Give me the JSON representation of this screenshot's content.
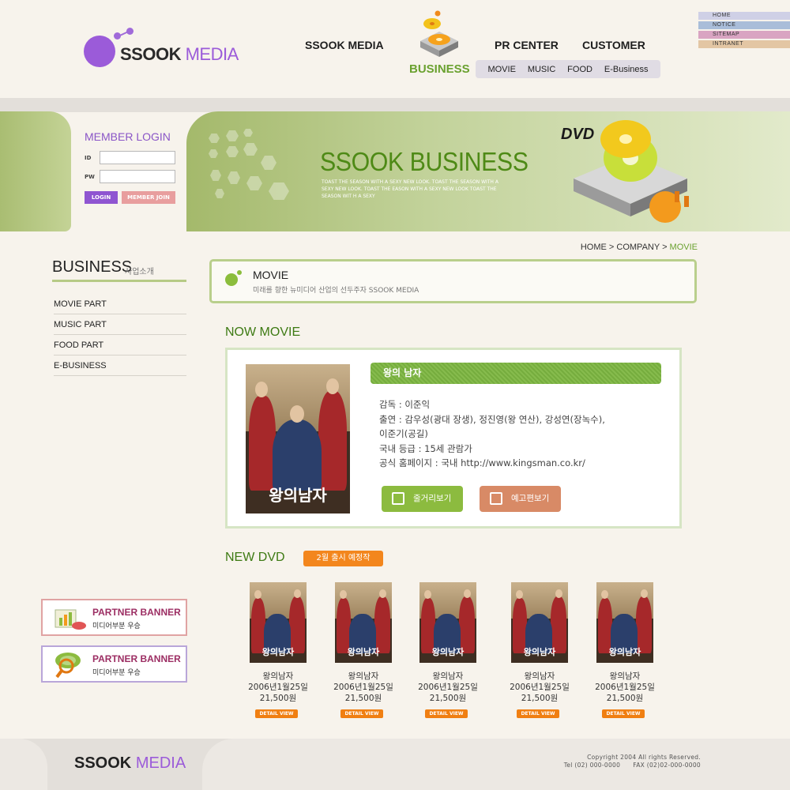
{
  "header": {
    "logo_bold": "SSOOK",
    "logo_light": "MEDIA",
    "gnb": [
      "SSOOK MEDIA",
      "BUSINESS",
      "PR CENTER",
      "CUSTOMER"
    ],
    "sub_menu": [
      "MOVIE",
      "MUSIC",
      "FOOD",
      "E-Business"
    ],
    "utility": [
      "HOME",
      "NOTICE",
      "SITEMAP",
      "INTRANET"
    ],
    "utility_colors": [
      "#cfd0e6",
      "#a9bdd9",
      "#d9a4c2",
      "#e3c6a4"
    ]
  },
  "login": {
    "title": "MEMBER LOGIN",
    "id_label": "ID",
    "pw_label": "PW",
    "login_button": "LOGIN",
    "join_button": "MEMBER JOIN"
  },
  "visual": {
    "title": "SSOOK BUSINESS",
    "desc": "TOAST THE SEASON WITH A SEXY NEW LOOK. TOAST THE SEASON WITH A SEXY NEW LOOK. TOAST THE EASON WITH A SEXY NEW LOOK TOAST THE SEASON WIT H A SEXY",
    "dvd_label": "DVD"
  },
  "sidebar": {
    "title": "BUSINESS",
    "subtitle": "사업소개",
    "items": [
      "MOVIE PART",
      "MUSIC PART",
      "FOOD PART",
      "E-BUSINESS"
    ],
    "banners": [
      {
        "title": "PARTNER BANNER",
        "sub": "미디어부분 우승"
      },
      {
        "title": "PARTNER BANNER",
        "sub": "미디어부분 우승"
      }
    ]
  },
  "breadcrumb": [
    "HOME",
    "COMPANY",
    "MOVIE"
  ],
  "page_head": {
    "title": "MOVIE",
    "desc": "미래를 향한 뉴미디어 산업의 선두주자 SSOOK MEDIA"
  },
  "now_movie": {
    "section_title": "NOW MOVIE",
    "poster_title": "왕의남자",
    "movie_title": "왕의 남자",
    "director": "감독 :  이준익",
    "cast_1": "출연 :  감우성(광대 장생), 정진영(왕 연산), 강성연(장녹수),",
    "cast_2": "이준기(공길)",
    "rating": "국내 등급 :  15세 관람가",
    "site": "공식 홈페이지 :  국내 http://www.kingsman.co.kr/",
    "btn_story": "줄거리보기",
    "btn_trailer": "예고편보기"
  },
  "new_dvd": {
    "section_title": "NEW DVD",
    "badge": "2월 출시 예정작",
    "items": [
      {
        "title": "왕의남자",
        "date": "2006년1월25일",
        "price": "21,500원",
        "button": "DETAIL VIEW"
      },
      {
        "title": "왕의남자",
        "date": "2006년1월25일",
        "price": "21,500원",
        "button": "DETAIL VIEW"
      },
      {
        "title": "왕의남자",
        "date": "2006년1월25일",
        "price": "21,500원",
        "button": "DETAIL VIEW"
      },
      {
        "title": "왕의남자",
        "date": "2006년1월25일",
        "price": "21,500원",
        "button": "DETAIL VIEW"
      },
      {
        "title": "왕의남자",
        "date": "2006년1월25일",
        "price": "21,500원",
        "button": "DETAIL VIEW"
      }
    ]
  },
  "footer": {
    "logo_bold": "SSOOK",
    "logo_light": "MEDIA",
    "copyright": "Copyright 2004 All rights Reserved.",
    "contact": "Tel (02) 000-0000      FAX (02)02-000-0000"
  }
}
